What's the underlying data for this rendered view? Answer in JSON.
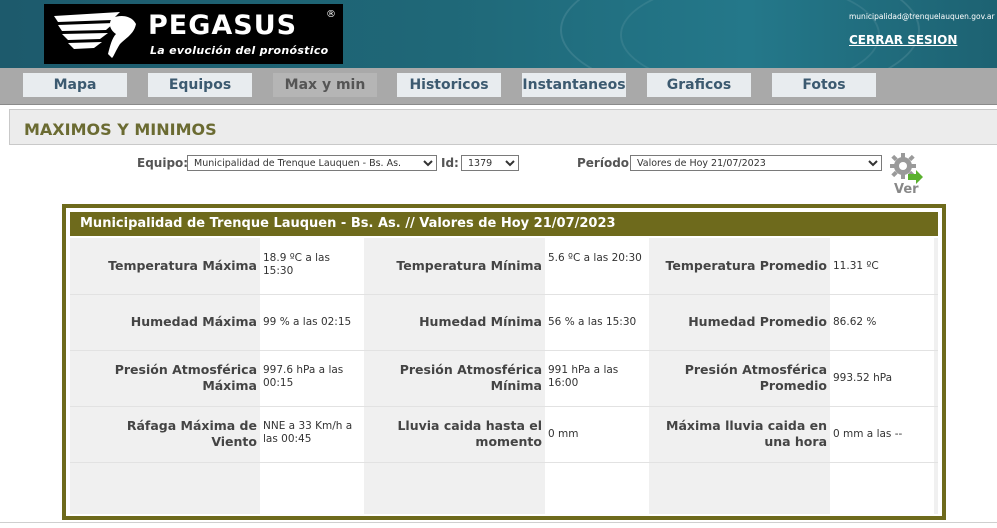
{
  "header": {
    "brand": "PEGASUS",
    "brand_mark": "®",
    "tagline": "La evolución del pronóstico",
    "user_email": "municipalidad@trenquelauquen.gov.ar",
    "logout_label": "CERRAR SESION",
    "colors": {
      "header_bg": "#1f6878",
      "logo_bg": "#000000"
    }
  },
  "nav": {
    "tabs": [
      {
        "label": "Mapa",
        "active": false
      },
      {
        "label": "Equipos",
        "active": false
      },
      {
        "label": "Max y min",
        "active": true
      },
      {
        "label": "Historicos",
        "active": false
      },
      {
        "label": "Instantaneos",
        "active": false
      },
      {
        "label": "Graficos",
        "active": false
      },
      {
        "label": "Fotos",
        "active": false
      }
    ]
  },
  "page": {
    "title": "MAXIMOS Y MINIMOS"
  },
  "filters": {
    "equipo_label": "Equipo:",
    "equipo_value": "Municipalidad de Trenque Lauquen - Bs. As.",
    "id_label": "Id:",
    "id_value": "1379",
    "periodo_label": "Período:",
    "periodo_value": "Valores de Hoy 21/07/2023",
    "ver_label": "Ver",
    "ver_icon": "gear-arrow-icon"
  },
  "panel": {
    "title": "Municipalidad de Trenque Lauquen - Bs. As. // Valores de Hoy 21/07/2023",
    "accent": "#6e6a1c",
    "rows": [
      [
        {
          "label": "Temperatura Máxima",
          "value": "18.9 ºC a las 15:30"
        },
        {
          "label": "Temperatura Mínima",
          "value": "5.6 ºC a las 20:30"
        },
        {
          "label": "Temperatura Promedio",
          "value": "11.31 ºC"
        }
      ],
      [
        {
          "label": "Humedad Máxima",
          "value": "99 % a las 02:15"
        },
        {
          "label": "Humedad Mínima",
          "value": "56 % a las 15:30"
        },
        {
          "label": "Humedad Promedio",
          "value": "86.62 %"
        }
      ],
      [
        {
          "label": "Presión Atmosférica Máxima",
          "value": "997.6 hPa a las 00:15"
        },
        {
          "label": "Presión Atmosférica Mínima",
          "value": "991 hPa a las 16:00"
        },
        {
          "label": "Presión Atmosférica Promedio",
          "value": "993.52 hPa"
        }
      ],
      [
        {
          "label": "Ráfaga Máxima de Viento",
          "value": "NNE a 33 Km/h a las 00:45"
        },
        {
          "label": "Lluvia caida hasta el momento",
          "value": "0 mm"
        },
        {
          "label": "Máxima lluvia caida en una hora",
          "value": "0 mm a las --"
        }
      ]
    ]
  }
}
